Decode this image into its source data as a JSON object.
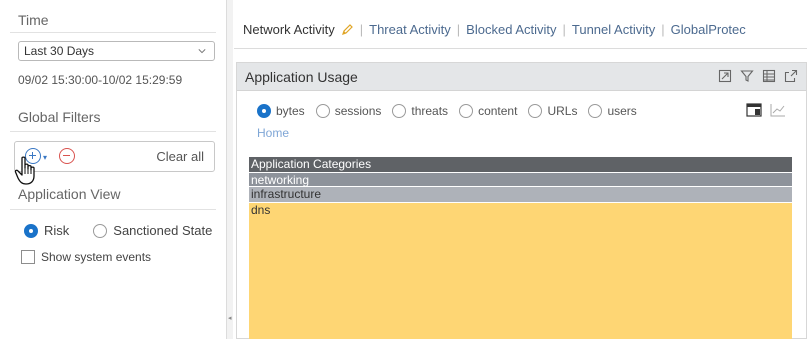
{
  "sidebar": {
    "time_title": "Time",
    "time_select": "Last 30 Days",
    "time_range": "09/02 15:30:00-10/02 15:29:59",
    "global_filters_title": "Global Filters",
    "clear_all": "Clear all",
    "application_view_title": "Application View",
    "view_options": [
      {
        "label": "Risk",
        "selected": true
      },
      {
        "label": "Sanctioned State",
        "selected": false
      }
    ],
    "show_system_events": "Show system events"
  },
  "tabs": [
    {
      "label": "Network Activity",
      "active": true
    },
    {
      "label": "Threat Activity",
      "active": false
    },
    {
      "label": "Blocked Activity",
      "active": false
    },
    {
      "label": "Tunnel Activity",
      "active": false
    },
    {
      "label": "GlobalProtec",
      "active": false
    }
  ],
  "widget": {
    "title": "Application Usage",
    "metrics": [
      {
        "label": "bytes",
        "selected": true
      },
      {
        "label": "sessions",
        "selected": false
      },
      {
        "label": "threats",
        "selected": false
      },
      {
        "label": "content",
        "selected": false
      },
      {
        "label": "URLs",
        "selected": false
      },
      {
        "label": "users",
        "selected": false
      }
    ],
    "breadcrumb": "Home",
    "treemap": {
      "header": "Application Categories",
      "rows": [
        "networking",
        "infrastructure",
        "dns"
      ]
    }
  },
  "colors": {
    "accent": "#1a73c9",
    "tab_link": "#4c6a8f",
    "treemap_header": "#5f6266",
    "networking": "#8e939b",
    "infrastructure": "#aeb2b9",
    "dns": "#fed674"
  }
}
